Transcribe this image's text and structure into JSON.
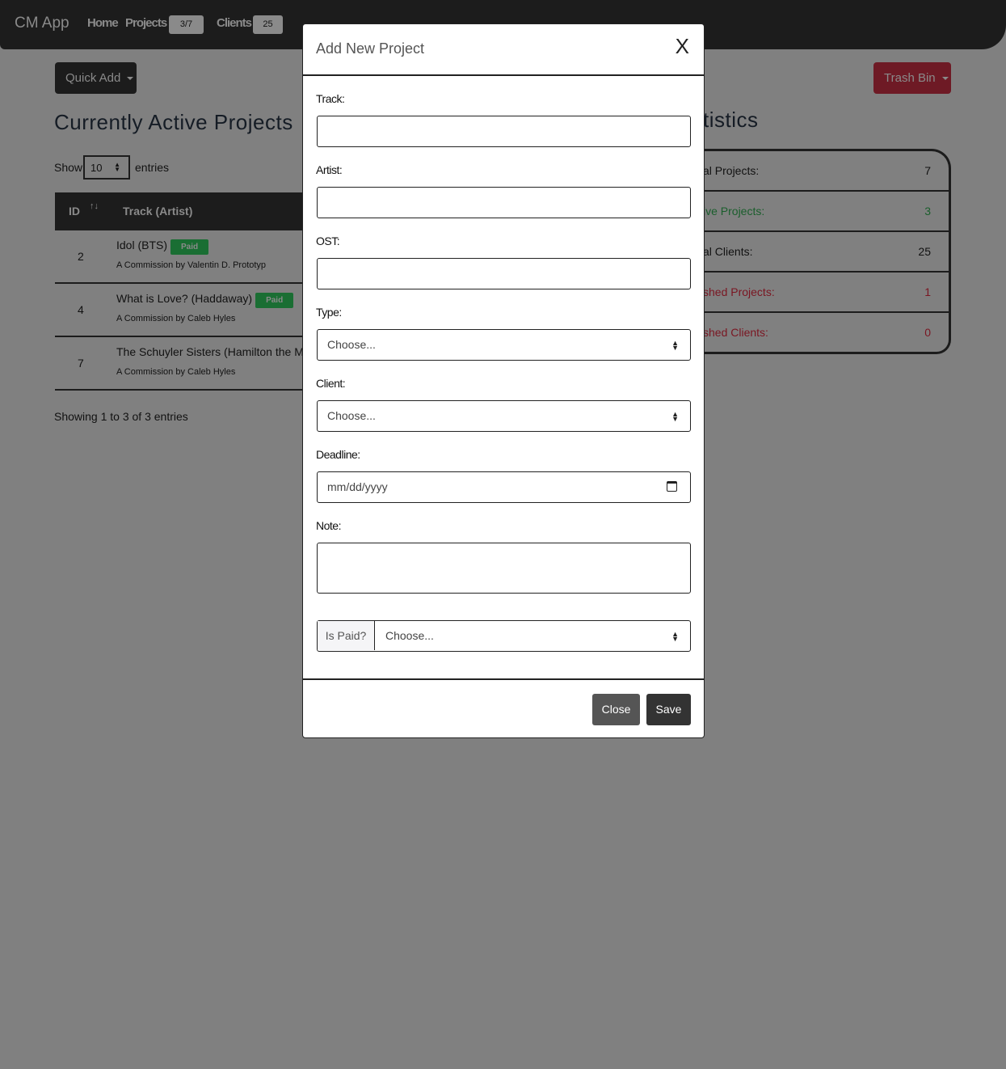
{
  "navbar": {
    "brand": "CM App",
    "links": [
      {
        "label": "Home"
      },
      {
        "label": "Projects",
        "badge": "3/7"
      },
      {
        "label": "Clients",
        "badge": "25"
      }
    ]
  },
  "quick_add": "Quick Add",
  "trash_bin": "Trash Bin",
  "projects": {
    "title": "Currently Active Projects",
    "show": "Show",
    "entries_value": "10",
    "entries": "entries",
    "columns": [
      "ID",
      "Track (Artist)"
    ],
    "rows": [
      {
        "id": "2",
        "track": "Idol (BTS)",
        "paid": "Paid",
        "sub": "A Commission by Valentin D. Prototyp"
      },
      {
        "id": "4",
        "track": "What is Love? (Haddaway)",
        "paid": "Paid",
        "sub": "A Commission by Caleb Hyles"
      },
      {
        "id": "7",
        "track": "The Schuyler Sisters (Hamilton the Mus",
        "sub": "A Commission by Caleb Hyles"
      }
    ],
    "footer": "Showing 1 to 3 of 3 entries"
  },
  "statistics": {
    "title": "tistics",
    "rows": [
      {
        "label": "al Projects:",
        "value": "7",
        "color": "#111111"
      },
      {
        "label": "ive Projects:",
        "value": "3",
        "color": "#1a5e2c"
      },
      {
        "label": "al Clients:",
        "value": "25",
        "color": "#111111"
      },
      {
        "label": "shed Projects:",
        "value": "1",
        "color": "#7a1622"
      },
      {
        "label": "shed Clients:",
        "value": "0",
        "color": "#7a1622"
      }
    ]
  },
  "modal": {
    "title": "Add New Project",
    "close_icon": "X",
    "fields": {
      "track": "Track:",
      "artist": "Artist:",
      "ost": "OST:",
      "type": "Type:",
      "type_value": "Choose...",
      "client": "Client:",
      "client_value": "Choose...",
      "deadline": "Deadline:",
      "deadline_placeholder": "mm/dd/yyyy",
      "note": "Note:",
      "is_paid": "Is Paid?",
      "is_paid_value": "Choose..."
    },
    "close": "Close",
    "save": "Save"
  }
}
